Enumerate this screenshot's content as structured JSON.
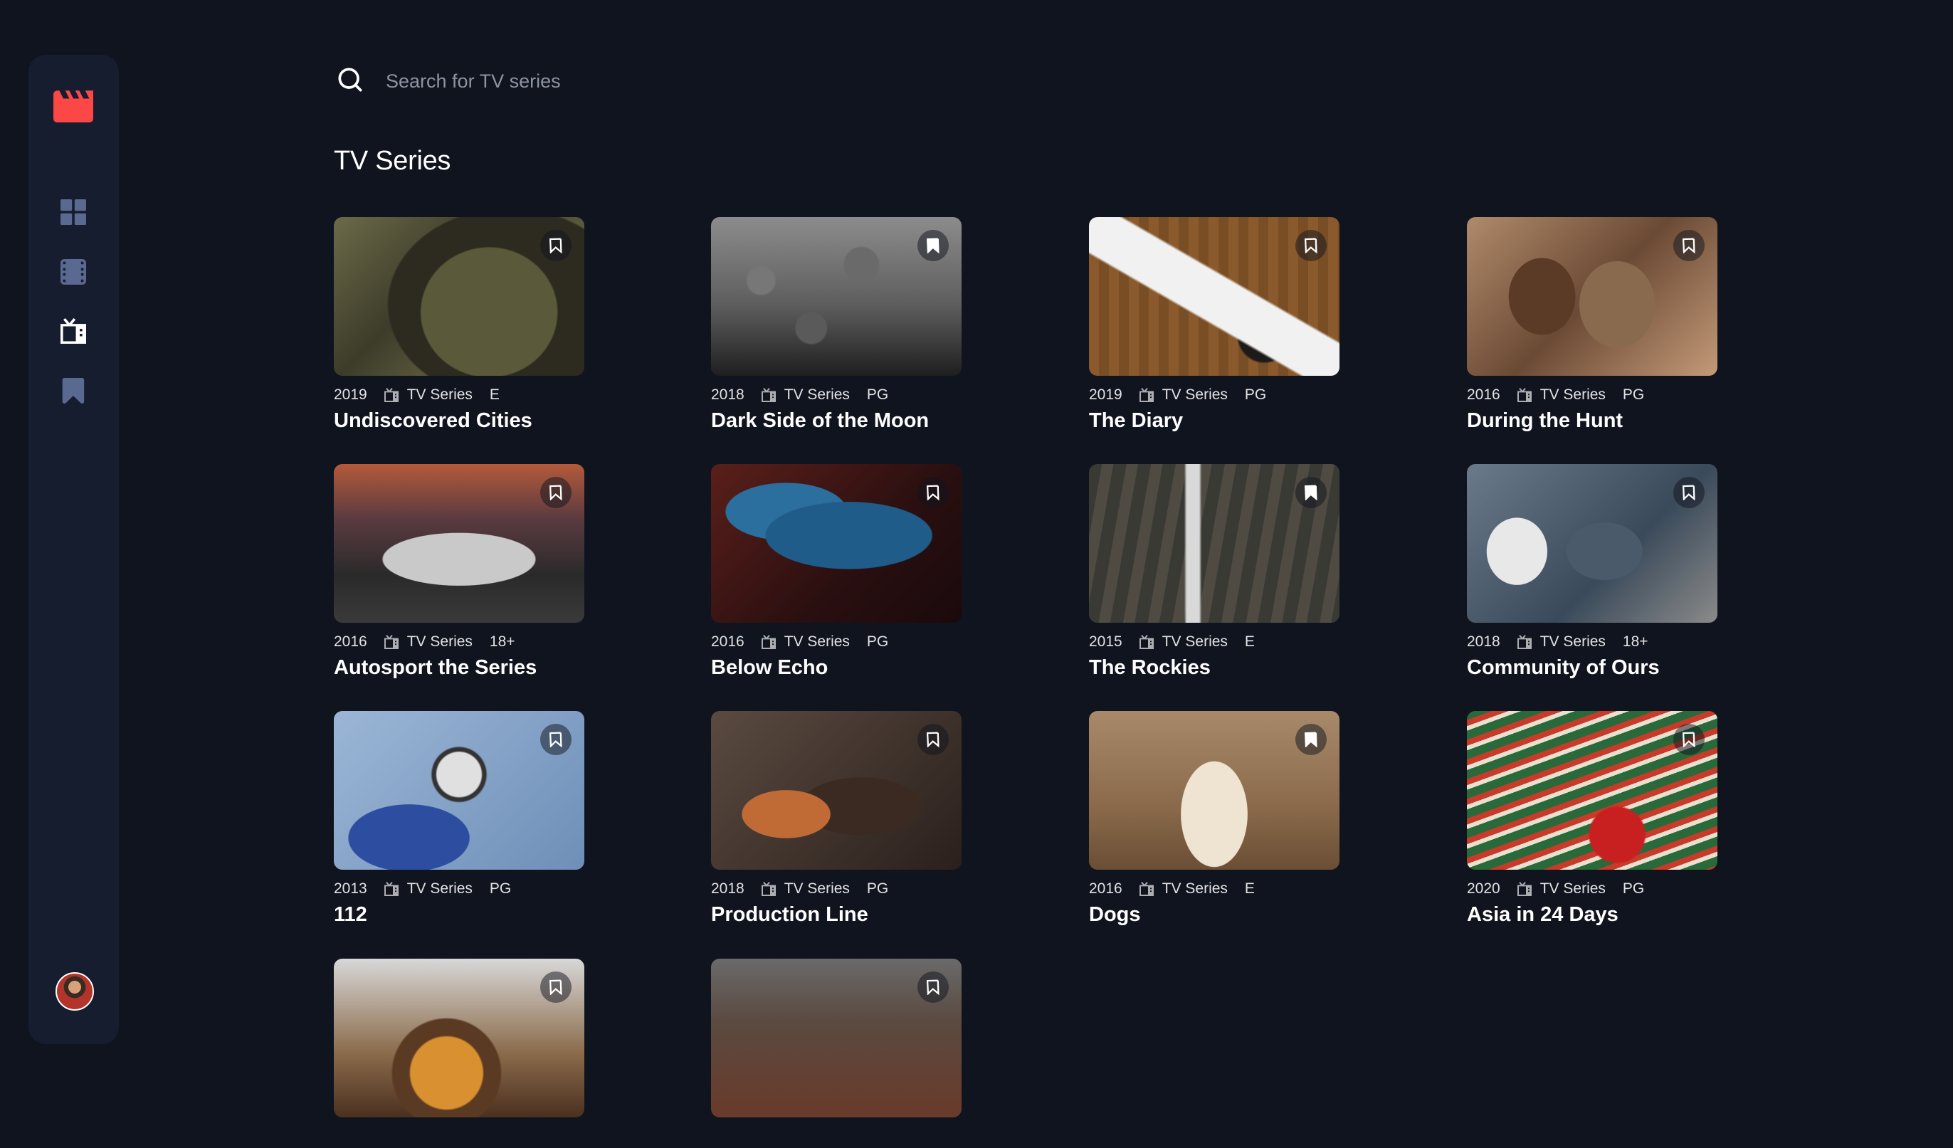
{
  "sidebar": {
    "logo_icon": "movie-clapper-icon",
    "nav": [
      {
        "name": "home",
        "icon": "grid-icon",
        "active": false
      },
      {
        "name": "movies",
        "icon": "film-icon",
        "active": false
      },
      {
        "name": "tv-series",
        "icon": "tv-icon",
        "active": true
      },
      {
        "name": "bookmarks",
        "icon": "bookmark-icon",
        "active": false
      }
    ]
  },
  "search": {
    "placeholder": "Search for TV series",
    "value": ""
  },
  "page": {
    "title": "TV Series"
  },
  "colors": {
    "background": "#10141e",
    "sidebar": "#161d2f",
    "accent": "#fc4747",
    "nav_inactive": "#5a698f",
    "text": "#ffffff"
  },
  "cards": [
    {
      "year": "2019",
      "category": "TV Series",
      "rating": "E",
      "title": "Undiscovered Cities",
      "bookmarked": false
    },
    {
      "year": "2018",
      "category": "TV Series",
      "rating": "PG",
      "title": "Dark Side of the Moon",
      "bookmarked": true
    },
    {
      "year": "2019",
      "category": "TV Series",
      "rating": "PG",
      "title": "The Diary",
      "bookmarked": false
    },
    {
      "year": "2016",
      "category": "TV Series",
      "rating": "PG",
      "title": "During the Hunt",
      "bookmarked": false
    },
    {
      "year": "2016",
      "category": "TV Series",
      "rating": "18+",
      "title": "Autosport the Series",
      "bookmarked": false
    },
    {
      "year": "2016",
      "category": "TV Series",
      "rating": "PG",
      "title": "Below Echo",
      "bookmarked": false
    },
    {
      "year": "2015",
      "category": "TV Series",
      "rating": "E",
      "title": "The Rockies",
      "bookmarked": true
    },
    {
      "year": "2018",
      "category": "TV Series",
      "rating": "18+",
      "title": "Community of Ours",
      "bookmarked": false
    },
    {
      "year": "2013",
      "category": "TV Series",
      "rating": "PG",
      "title": "112",
      "bookmarked": false
    },
    {
      "year": "2018",
      "category": "TV Series",
      "rating": "PG",
      "title": "Production Line",
      "bookmarked": false
    },
    {
      "year": "2016",
      "category": "TV Series",
      "rating": "E",
      "title": "Dogs",
      "bookmarked": true
    },
    {
      "year": "2020",
      "category": "TV Series",
      "rating": "PG",
      "title": "Asia in 24 Days",
      "bookmarked": false
    },
    {
      "year": "",
      "category": "",
      "rating": "",
      "title": "",
      "bookmarked": false
    },
    {
      "year": "",
      "category": "",
      "rating": "",
      "title": "",
      "bookmarked": false
    }
  ]
}
